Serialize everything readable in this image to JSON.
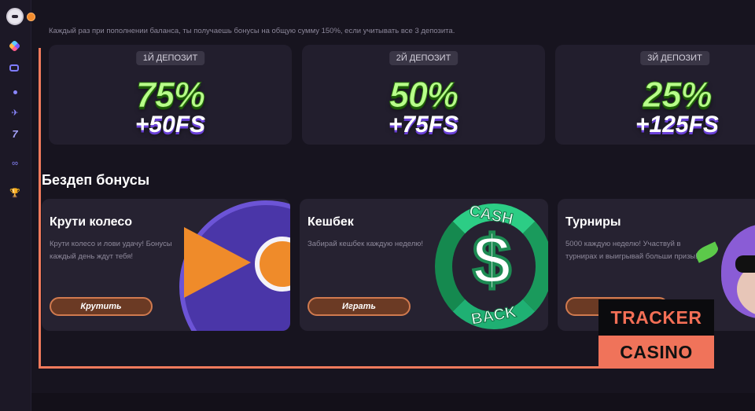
{
  "sidebar": {
    "icons": [
      "logo-icon",
      "play-icon",
      "gem-icon",
      "tv-icon",
      "dot-icon",
      "plane-icon",
      "seven-icon",
      "link-icon",
      "cup-icon"
    ]
  },
  "header": {
    "subtitle": "Каждый раз при пополнении баланса, ты получаешь бонусы на общую сумму 150%, если учитывать все 3 депозита."
  },
  "deposits": [
    {
      "label": "1Й ДЕПОЗИТ",
      "percent": "75%",
      "fs": "+50FS"
    },
    {
      "label": "2Й ДЕПОЗИТ",
      "percent": "50%",
      "fs": "+75FS"
    },
    {
      "label": "3Й ДЕПОЗИТ",
      "percent": "25%",
      "fs": "+125FS"
    }
  ],
  "bonuses_section": {
    "title": "Бездеп бонусы",
    "cards": [
      {
        "title": "Крути колесо",
        "desc": "Крути колесо и лови удачу! Бонусы каждый день ждут тебя!",
        "button": "Крутить"
      },
      {
        "title": "Кешбек",
        "desc": "Забирай кешбек каждую неделю!",
        "button": "Играть",
        "art_top": "CASH",
        "art_bottom": "BACK"
      },
      {
        "title": "Турниры",
        "desc": "5000 каждую неделю! Участвуй в турнирах и выигрывай больши призы!",
        "button": "Уч"
      }
    ]
  },
  "watermark": {
    "line1": "TRACKER",
    "line2": "CASINO"
  },
  "colors": {
    "accent": "#f07a5c",
    "green": "#b8ff8a",
    "purple": "#6a40d8",
    "button_border": "#d07a4f"
  }
}
